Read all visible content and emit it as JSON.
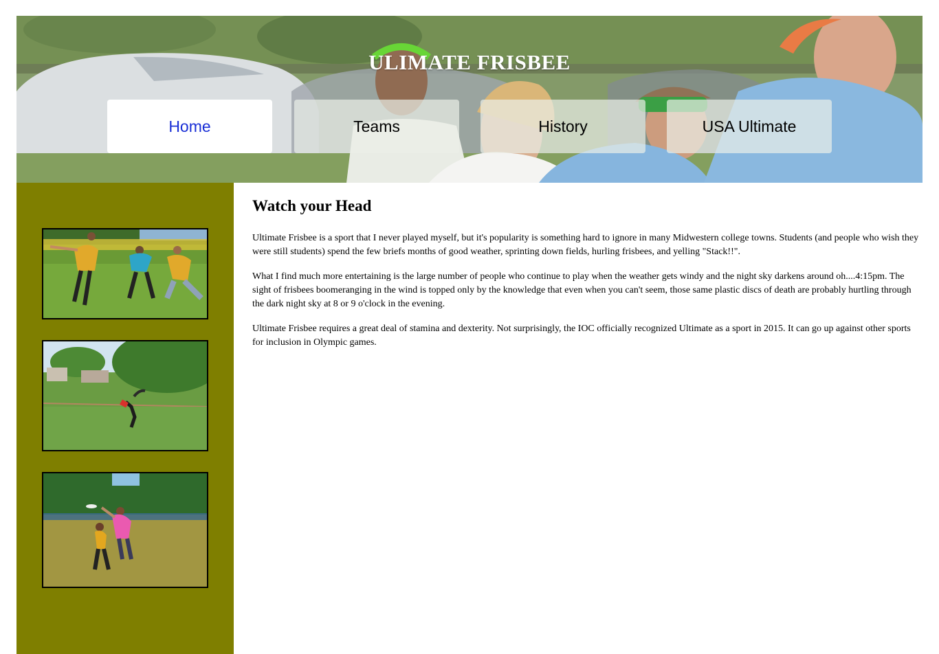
{
  "header": {
    "title": "ULIMATE FRISBEE",
    "banner_image": "ultimate-players-banner-photo"
  },
  "nav": {
    "items": [
      {
        "label": "Home",
        "active": true
      },
      {
        "label": "Teams",
        "active": false
      },
      {
        "label": "History",
        "active": false
      },
      {
        "label": "USA Ultimate",
        "active": false
      }
    ]
  },
  "sidebar": {
    "background": "#7f7f00",
    "photos": [
      {
        "name": "ultimate-huddle-photo"
      },
      {
        "name": "ultimate-field-catch-photo"
      },
      {
        "name": "ultimate-jump-catch-photo"
      }
    ]
  },
  "main": {
    "heading": "Watch your Head",
    "paragraphs": [
      "Ultimate Frisbee is a sport that I never played myself, but it's popularity is something hard to ignore in many Midwestern college towns. Students (and people who wish they were still students) spend the few briefs months of good weather, sprinting down fields, hurling frisbees, and yelling \"Stack!!\".",
      "What I find much more entertaining is the large number of people who continue to play when the weather gets windy and the night sky darkens around oh....4:15pm. The sight of frisbees boomeranging in the wind is topped only by the knowledge that even when you can't seem, those same plastic discs of death are probably hurtling through the dark night sky at 8 or 9 o'clock in the evening.",
      "Ultimate Frisbee requires a great deal of stamina and dexterity. Not surprisingly, the IOC officially recognized Ultimate as a sport in 2015. It can go up against other sports for inclusion in Olympic games."
    ]
  },
  "colors": {
    "nav_active_text": "#1a2fd6",
    "sidebar": "#7f7f00"
  }
}
